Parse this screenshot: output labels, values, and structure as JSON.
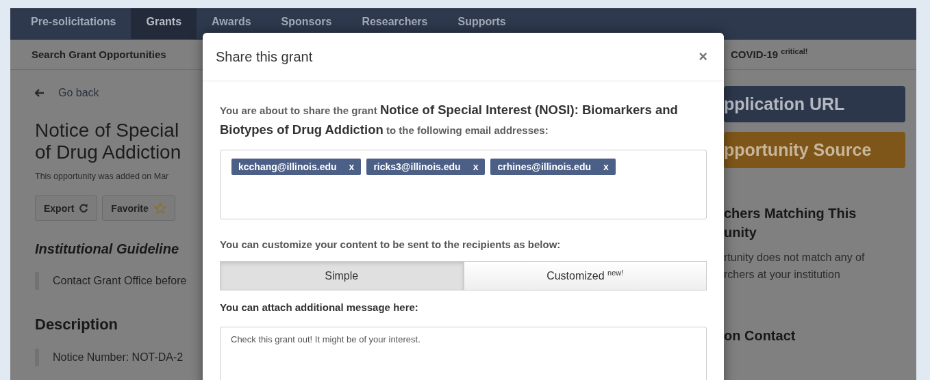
{
  "nav": {
    "items": [
      {
        "label": "Pre-solicitations",
        "selected": false
      },
      {
        "label": "Grants",
        "selected": true
      },
      {
        "label": "Awards",
        "selected": false
      },
      {
        "label": "Sponsors",
        "selected": false
      },
      {
        "label": "Researchers",
        "selected": false
      },
      {
        "label": "Supports",
        "selected": false
      }
    ]
  },
  "subnav": {
    "left": "Search Grant Opportunities",
    "right": "COVID-19 $^{critical!}$"
  },
  "page": {
    "back_link": "Go back",
    "title_lines": [
      "Notice of Special",
      "of Drug Addiction"
    ],
    "added_note": "This opportunity was added on Mar",
    "buttons": [
      {
        "label": "Export",
        "kind": "export"
      },
      {
        "label": "Favorite",
        "kind": "favorite"
      }
    ],
    "guidelines_heading": "Institutional Guideline",
    "guidelines_text": "Contact Grant Office before",
    "description_heading": "Description",
    "description_text": "Notice Number: NOT-DA-2"
  },
  "sidebar": {
    "buttons": [
      {
        "label": "pplication URL",
        "kind": "primary"
      },
      {
        "label": "pportunity Source",
        "kind": "warning"
      }
    ],
    "match_heading_lines": [
      "chers Matching This",
      "unity"
    ],
    "match_text_lines": [
      "rtunity does not match any of",
      "rchers at your institution"
    ],
    "contact_heading": "on Contact"
  },
  "modal": {
    "title": "Share this grant",
    "close": "×",
    "intro": "You are about to share the grant **Notice of Special Interest (NOSI): Biomarkers and Biotypes of Drug Addiction** to the following email addresses:",
    "recipients": [
      {
        "email": "kcchang@illinois.edu",
        "remove": "x"
      },
      {
        "email": "ricks3@illinois.edu",
        "remove": "x"
      },
      {
        "email": "crhines@illinois.edu",
        "remove": "x"
      }
    ],
    "customize_label": "You can customize your content to be sent to the recipients as below:",
    "modes": [
      {
        "label": "Simple",
        "selected": true
      },
      {
        "label": "Customized $^{new!}$",
        "selected": false
      }
    ],
    "message_label": "You can attach additional message here:",
    "message": "Check this grant out! It might be of your interest."
  }
}
